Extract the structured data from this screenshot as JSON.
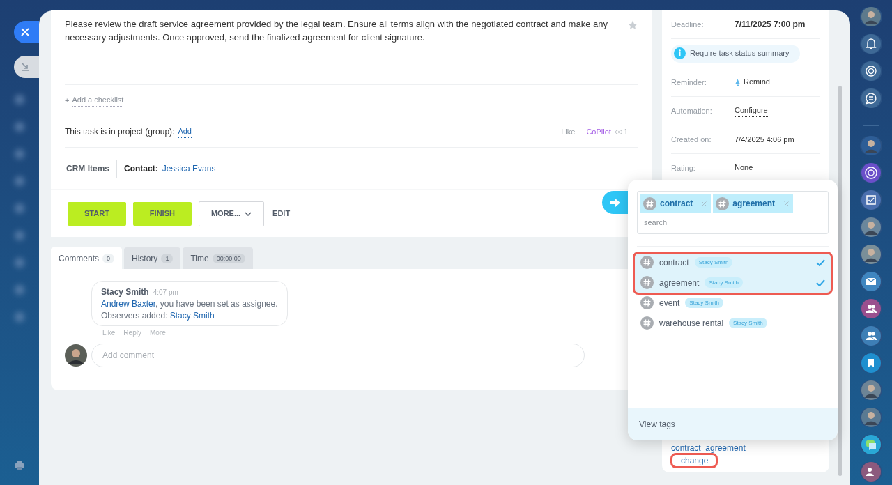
{
  "description": "Please review the draft service agreement provided by the legal team. Ensure all terms align with the negotiated contract and make any necessary adjustments. Once approved, send the finalized agreement for client signature.",
  "starred": false,
  "checklist": {
    "plus": "+",
    "link": "Add a checklist"
  },
  "project": {
    "label": "This task is in project (group):",
    "link": "Add"
  },
  "reactions": {
    "like": "Like",
    "copilot": "CoPilot",
    "views": "1"
  },
  "crm": {
    "title": "CRM Items",
    "contact_label": "Contact:",
    "contact_name": "Jessica Evans"
  },
  "actions": [
    {
      "label": "START",
      "kind": "primary"
    },
    {
      "label": "FINISH",
      "kind": "primary"
    },
    {
      "label": "MORE...",
      "kind": "dropdown"
    },
    {
      "label": "EDIT",
      "kind": "link"
    }
  ],
  "tabs": [
    {
      "label": "Comments",
      "count": "0",
      "selected": true
    },
    {
      "label": "History",
      "count": "1",
      "selected": false
    },
    {
      "label": "Time",
      "count": "00:00:00",
      "selected": false
    }
  ],
  "comments": [
    {
      "author": "Stacy Smith",
      "time": "4:07 pm",
      "lines": [
        {
          "segments": [
            {
              "text": "Andrew Baxter",
              "link": true
            },
            {
              "text": ", you have been set as assignee.",
              "link": false
            }
          ]
        },
        {
          "segments": [
            {
              "text": "Observers added: ",
              "link": false
            },
            {
              "text": "Stacy Smith",
              "link": true
            }
          ]
        }
      ],
      "actions": [
        "Like",
        "Reply",
        "More"
      ]
    }
  ],
  "comment_field": {
    "placeholder": "Add comment"
  },
  "details": [
    {
      "kind": "deadline",
      "label": "Deadline:",
      "value": "7/11/2025 7:00 pm"
    },
    {
      "kind": "notice",
      "value": "Require task status summary"
    },
    {
      "kind": "reminder",
      "label": "Reminder:",
      "value": "Remind"
    },
    {
      "kind": "link",
      "label": "Automation:",
      "value": "Configure"
    },
    {
      "kind": "text",
      "label": "Created on:",
      "value": "7/4/2025 4:06 pm"
    },
    {
      "kind": "link",
      "label": "Rating:",
      "value": "None"
    }
  ],
  "tag_picker": {
    "chips": [
      "contract",
      "agreement"
    ],
    "placeholder": "search",
    "tags": [
      {
        "name": "contract",
        "author": "Stacy Smith",
        "selected": true
      },
      {
        "name": "agreement",
        "author": "Stacy Smith",
        "selected": true
      },
      {
        "name": "event",
        "author": "Stacy Smith",
        "selected": false
      },
      {
        "name": "warehouse rental",
        "author": "Stacy Smith",
        "selected": false
      }
    ],
    "footer": "View tags"
  },
  "tags_value": "contract  agreement",
  "change_link": "change"
}
